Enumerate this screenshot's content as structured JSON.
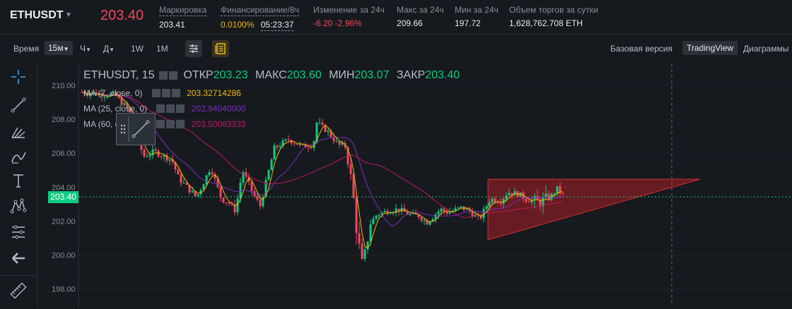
{
  "header": {
    "symbol": "ETHUSDT",
    "last_price": "203.40",
    "stats": [
      {
        "label": "Маркировка",
        "value": "203.41"
      },
      {
        "label": "Финансирование/8ч",
        "value": "0.0100%",
        "countdown": "05:23:37"
      },
      {
        "label": "Изменение за 24ч",
        "value": "-6.20 -2.96%"
      },
      {
        "label": "Макс за 24ч",
        "value": "209.66"
      },
      {
        "label": "Мин за 24ч",
        "value": "197.72"
      },
      {
        "label": "Объем торгов за сутки",
        "value": "1,628,762.708 ETH"
      }
    ]
  },
  "toolbar": {
    "time_label": "Время",
    "intervals": [
      "15м",
      "Ч",
      "Д",
      "1W",
      "1M"
    ],
    "views": [
      "Базовая версия",
      "TradingView",
      "Диаграммы"
    ]
  },
  "legend": {
    "title": "ETHUSDT, 15",
    "open_label": "ОТКР",
    "open": "203.23",
    "high_label": "МАКС",
    "high": "203.60",
    "low_label": "МИН",
    "low": "203.07",
    "close_label": "ЗАКР",
    "close": "203.40",
    "ma": [
      {
        "label": "MA (7, close, 0)",
        "value": "203.32714286",
        "color": "#f0b90b"
      },
      {
        "label": "MA (25, close, 0)",
        "value": "202.94040000",
        "color": "#7b2cbf"
      },
      {
        "label": "MA (60, close, 0)",
        "value": "203.50083333",
        "color": "#c2185b"
      }
    ]
  },
  "price_axis": {
    "ticks": [
      "210.00",
      "208.00",
      "206.00",
      "204.00",
      "203.40",
      "202.00",
      "200.00",
      "198.00"
    ],
    "current_price": "203.40"
  },
  "colors": {
    "up": "#0ecb81",
    "down": "#f6465d",
    "background": "#161a1e"
  }
}
